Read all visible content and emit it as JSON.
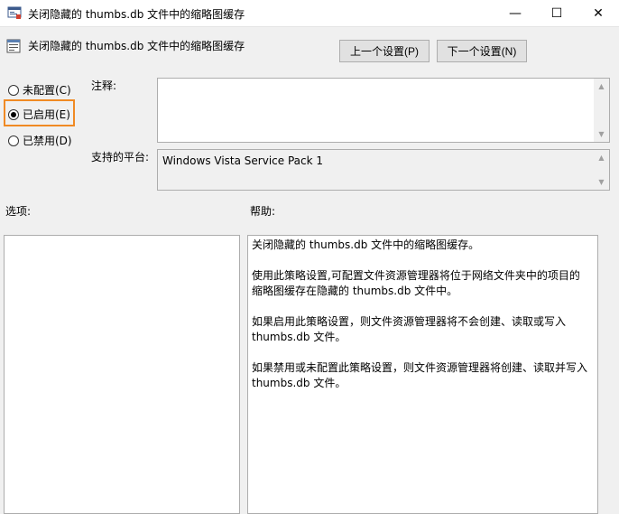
{
  "window": {
    "title": "关闭隐藏的 thumbs.db 文件中的缩略图缓存",
    "minimize_glyph": "—",
    "maximize_glyph": "☐",
    "close_glyph": "✕"
  },
  "header": {
    "policy_name": "关闭隐藏的 thumbs.db 文件中的缩略图缓存",
    "prev_button": "上一个设置(P)",
    "next_button": "下一个设置(N)"
  },
  "state": {
    "options": [
      {
        "label": "未配置(C)",
        "selected": false
      },
      {
        "label": "已启用(E)",
        "selected": true
      },
      {
        "label": "已禁用(D)",
        "selected": false
      }
    ],
    "highlight_color": "#f08a24"
  },
  "fields": {
    "note_label": "注释:",
    "note_value": "",
    "platform_label": "支持的平台:",
    "platform_value": "Windows Vista Service Pack 1"
  },
  "sections": {
    "options_label": "选项:",
    "help_label": "帮助:"
  },
  "help": {
    "paragraphs": [
      "关闭隐藏的 thumbs.db 文件中的缩略图缓存。",
      "使用此策略设置,可配置文件资源管理器将位于网络文件夹中的项目的缩略图缓存在隐藏的 thumbs.db 文件中。",
      "如果启用此策略设置，则文件资源管理器将不会创建、读取或写入 thumbs.db 文件。",
      "如果禁用或未配置此策略设置，则文件资源管理器将创建、读取并写入 thumbs.db 文件。"
    ]
  }
}
